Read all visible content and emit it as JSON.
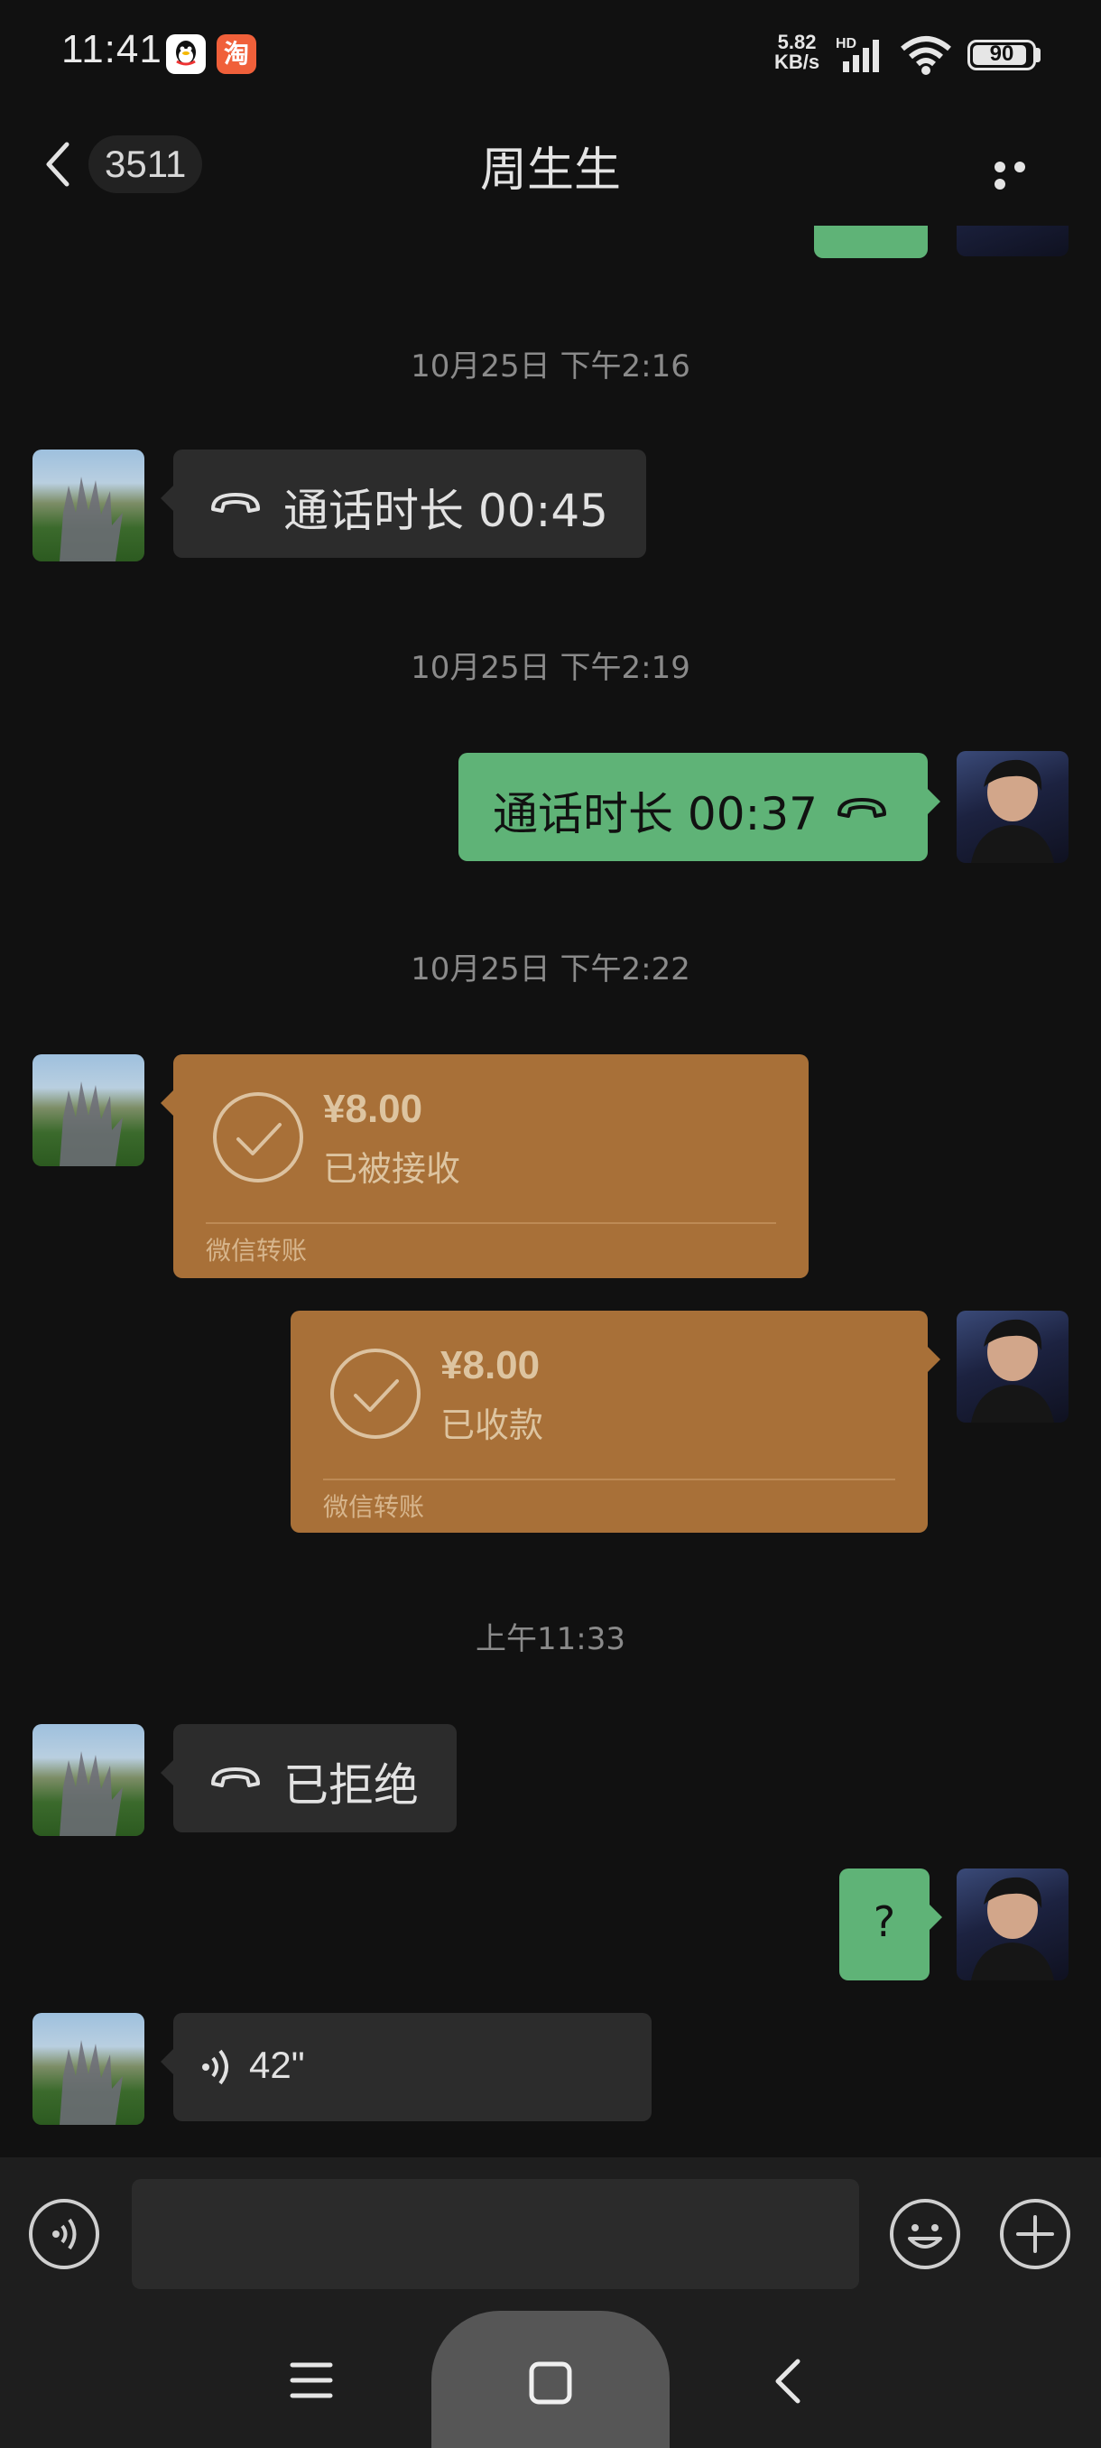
{
  "status_bar": {
    "time": "11:41",
    "taobao_glyph": "淘",
    "net_speed_value": "5.82",
    "net_speed_unit": "KB/s",
    "hd": "HD",
    "battery": "90"
  },
  "header": {
    "unread_count": "3511",
    "title": "周生生"
  },
  "messages": {
    "ts1": "10月25日 下午2:16",
    "call1": "通话时长 00:45",
    "ts2": "10月25日 下午2:19",
    "call2": "通话时长 00:37",
    "ts3": "10月25日 下午2:22",
    "transfer1": {
      "amount": "¥8.00",
      "status": "已被接收",
      "label": "微信转账"
    },
    "transfer2": {
      "amount": "¥8.00",
      "status": "已收款",
      "label": "微信转账"
    },
    "ts4": "上午11:33",
    "call3": "已拒绝",
    "text1": "?",
    "voice1": "42\""
  },
  "colors": {
    "background": "#111111",
    "bubble_gray": "#2c2c2c",
    "bubble_green": "#5fb377",
    "bubble_orange": "#a87038"
  },
  "icons": [
    "back-arrow-icon",
    "more-icon",
    "phone-hangup-icon",
    "check-circle-icon",
    "voice-icon",
    "emoji-icon",
    "plus-icon",
    "menu-icon",
    "home-icon",
    "nav-back-icon"
  ]
}
